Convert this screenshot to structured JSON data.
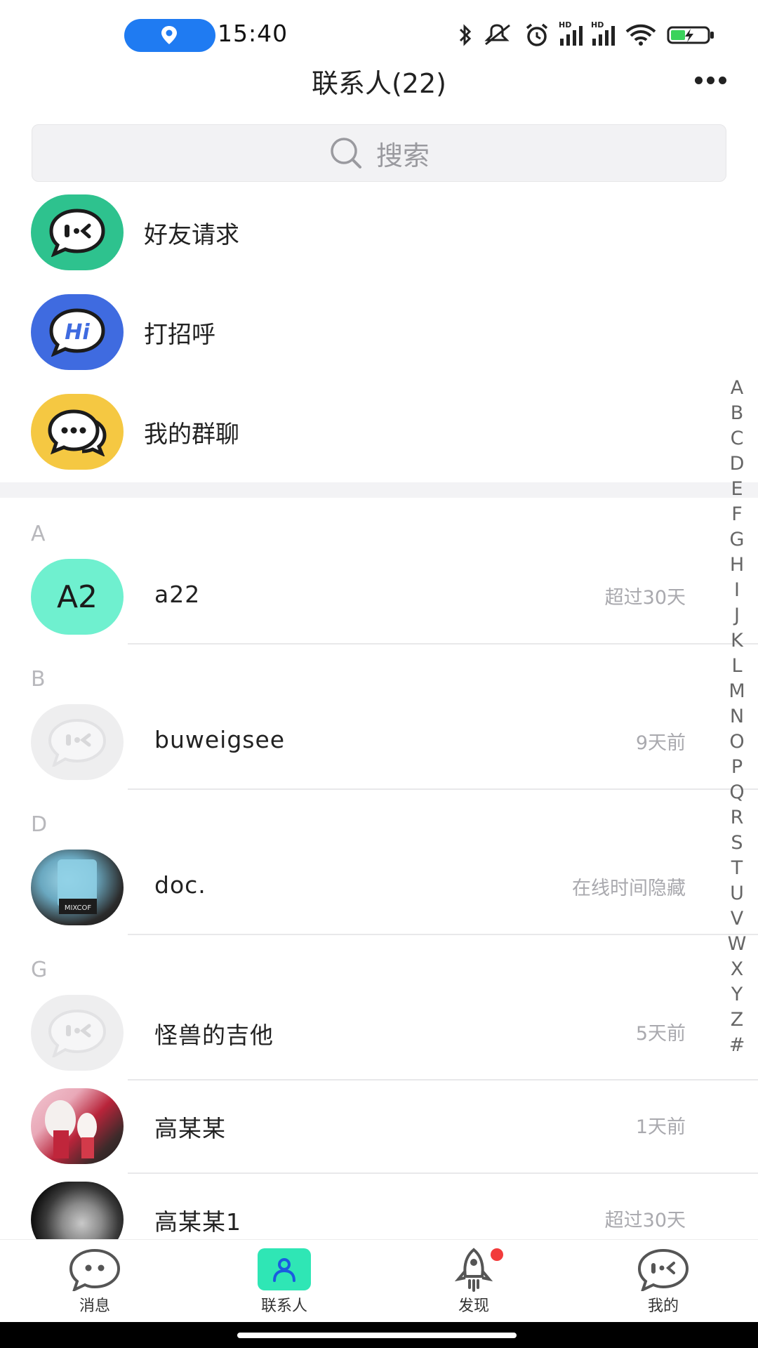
{
  "status_bar": {
    "time": "15:40"
  },
  "header": {
    "title": "联系人(22)"
  },
  "search": {
    "placeholder": "搜索"
  },
  "entries": [
    {
      "label": "好友请求",
      "icon": "friend-request-icon",
      "color": "#2ec28e"
    },
    {
      "label": "打招呼",
      "icon": "hi-icon",
      "color": "#3f6be0",
      "icon_text": "Hi"
    },
    {
      "label": "我的群聊",
      "icon": "group-chat-icon",
      "color": "#f5c842"
    }
  ],
  "contacts": {
    "groups": [
      {
        "letter": "A",
        "items": [
          {
            "name": "a22",
            "status": "超过30天",
            "avatar_text": "A2"
          }
        ]
      },
      {
        "letter": "B",
        "items": [
          {
            "name": "buweigsee",
            "status": "9天前"
          }
        ]
      },
      {
        "letter": "D",
        "items": [
          {
            "name": "doc.",
            "status": "在线时间隐藏",
            "avatar_photo_text": "MIXCOF"
          }
        ]
      },
      {
        "letter": "G",
        "items": [
          {
            "name": "怪兽的吉他",
            "status": "5天前"
          },
          {
            "name": "高某某",
            "status": "1天前"
          },
          {
            "name": "高某某1",
            "status": "超过30天"
          }
        ]
      }
    ]
  },
  "alphabet_index": [
    "A",
    "B",
    "C",
    "D",
    "E",
    "F",
    "G",
    "H",
    "I",
    "J",
    "K",
    "L",
    "M",
    "N",
    "O",
    "P",
    "Q",
    "R",
    "S",
    "T",
    "U",
    "V",
    "W",
    "X",
    "Y",
    "Z",
    "#"
  ],
  "bottom_nav": [
    {
      "label": "消息",
      "icon": "message-icon",
      "active": false
    },
    {
      "label": "联系人",
      "icon": "contacts-icon",
      "active": true
    },
    {
      "label": "发现",
      "icon": "discover-rocket-icon",
      "active": false,
      "badge": true
    },
    {
      "label": "我的",
      "icon": "profile-icon",
      "active": false
    }
  ],
  "colors": {
    "accent": "#2fe6b5",
    "badge": "#f23b3b",
    "location_pill": "#1f7bf2"
  }
}
